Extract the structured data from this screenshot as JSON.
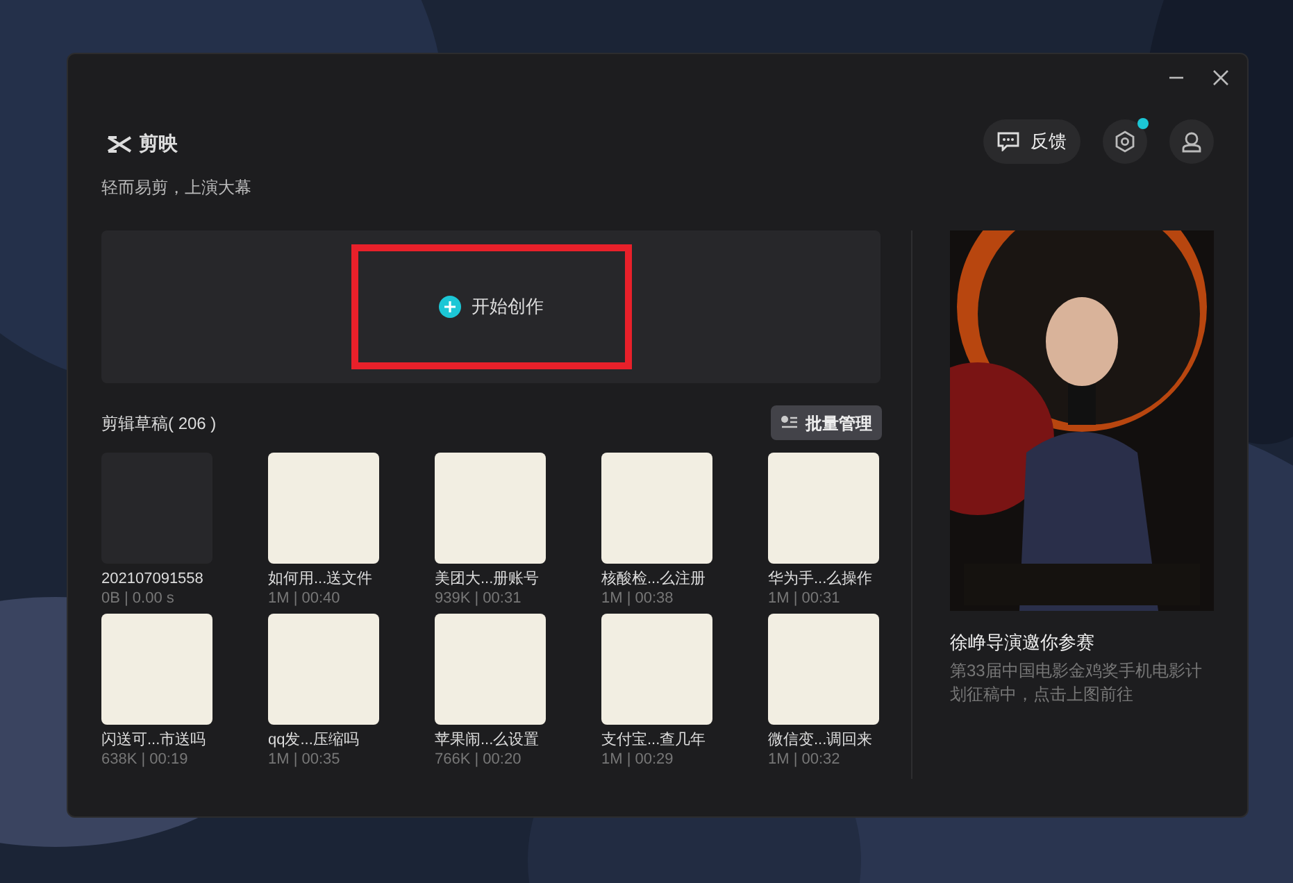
{
  "header": {
    "app_name": "剪映",
    "tagline": "轻而易剪，上演大幕",
    "feedback_button": "反馈",
    "settings_has_badge": true
  },
  "start_button": {
    "label": "开始创作",
    "highlighted": true
  },
  "drafts": {
    "title": "剪辑草稿( 206 )",
    "batch_button": "批量管理",
    "items": [
      {
        "kind": "empty",
        "title": "202107091558",
        "meta": "0B | 0.00 s"
      },
      {
        "kind": "cover",
        "title": "如何用...送文件",
        "meta": "1M | 00:40"
      },
      {
        "kind": "cover",
        "title": "美团大...册账号",
        "meta": "939K | 00:31"
      },
      {
        "kind": "cover",
        "title": "核酸检...么注册",
        "meta": "1M | 00:38"
      },
      {
        "kind": "cover",
        "title": "华为手...么操作",
        "meta": "1M | 00:31"
      },
      {
        "kind": "cover",
        "title": "闪送可...市送吗",
        "meta": "638K | 00:19"
      },
      {
        "kind": "cover",
        "title": "qq发...压缩吗",
        "meta": "1M | 00:35"
      },
      {
        "kind": "cover",
        "title": "苹果闹...么设置",
        "meta": "766K | 00:20"
      },
      {
        "kind": "cover",
        "title": "支付宝...查几年",
        "meta": "1M | 00:29"
      },
      {
        "kind": "cover",
        "title": "微信变...调回来",
        "meta": "1M | 00:32"
      }
    ]
  },
  "promo": {
    "kind": "picture",
    "title": "徐峥导演邀你参赛",
    "description": "第33届中国电影金鸡奖手机电影计划征稿中，点击上图前往"
  }
}
